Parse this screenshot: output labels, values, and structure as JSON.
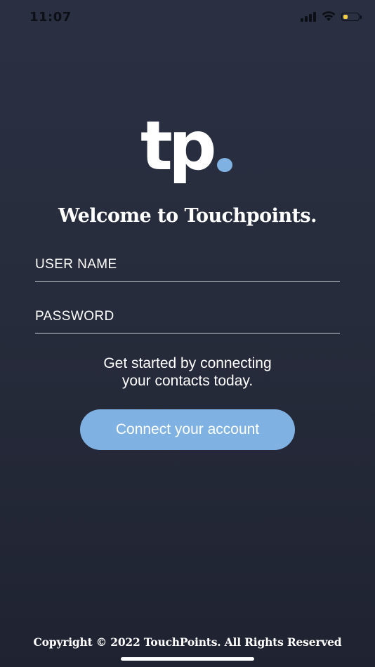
{
  "status_bar": {
    "time": "11:07",
    "icons": [
      "cellular-signal-icon",
      "wifi-icon",
      "battery-icon"
    ],
    "battery_color": "#f4d03f"
  },
  "logo": {
    "text": "tp",
    "dot_color": "#7fb2e3"
  },
  "welcome": {
    "title": "Welcome to Touchpoints."
  },
  "form": {
    "username_placeholder": "USER NAME",
    "username_value": "",
    "password_placeholder": "PASSWORD",
    "password_value": ""
  },
  "tagline": {
    "line1": "Get started by connecting",
    "line2": "your contacts today."
  },
  "connect_button": {
    "label": "Connect your account",
    "color": "#7fb2e3"
  },
  "footer": {
    "copyright": "Copyright © 2022 TouchPoints. All Rights Reserved"
  },
  "colors": {
    "background": "#282d3d",
    "text": "#ffffff"
  }
}
